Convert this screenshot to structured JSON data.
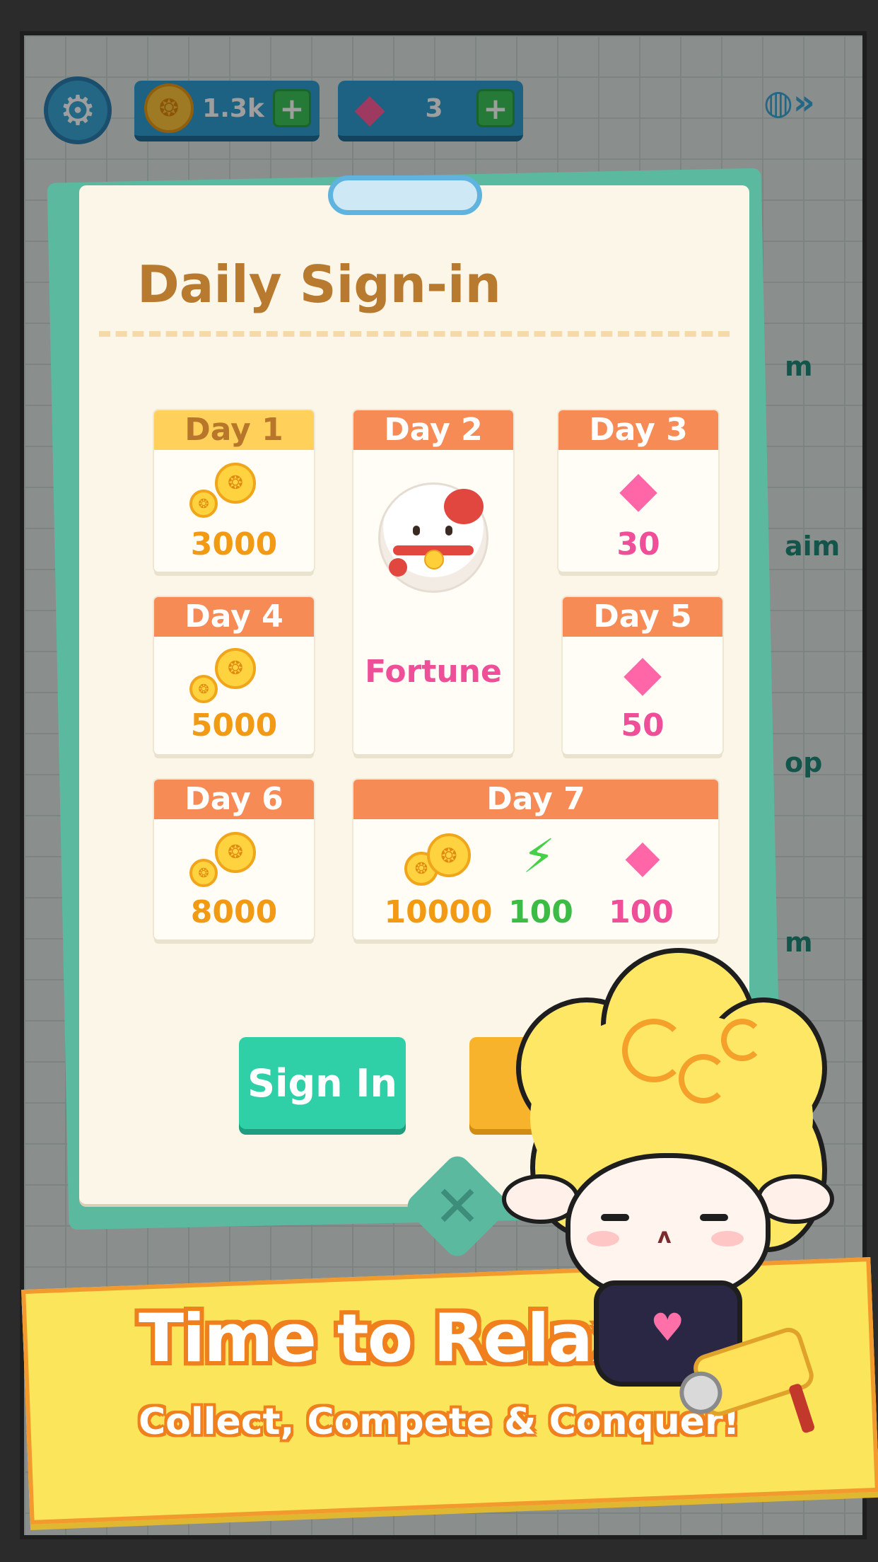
{
  "top_bar": {
    "coins": "1.3k",
    "gems": "3",
    "plus_symbol": "+"
  },
  "modal": {
    "title": "Daily Sign-in",
    "days": [
      {
        "label": "Day 1",
        "reward": "3000",
        "kind": "coin"
      },
      {
        "label": "Day 2",
        "reward": "Fortune",
        "kind": "lucky-cat"
      },
      {
        "label": "Day 3",
        "reward": "30",
        "kind": "gem"
      },
      {
        "label": "Day 4",
        "reward": "5000",
        "kind": "coin"
      },
      {
        "label": "Day 5",
        "reward": "50",
        "kind": "gem"
      },
      {
        "label": "Day 6",
        "reward": "8000",
        "kind": "coin"
      },
      {
        "label": "Day 7",
        "rewards": {
          "coins": "10000",
          "energy": "100",
          "gems": "100"
        }
      }
    ],
    "sign_in_label": "Sign In",
    "close_symbol": "✕"
  },
  "side_peek": {
    "text1": "m",
    "text2": "aim",
    "text3": "op",
    "text4": "m"
  },
  "banner": {
    "title": "Time to Relax",
    "subtitle": "Collect, Compete & Conquer!"
  },
  "colors": {
    "accent_teal": "#2fcfa8",
    "coin_orange": "#f39a14",
    "gem_pink": "#ee4f98",
    "energy_green": "#3cbb45",
    "banner_yellow": "#fbe65b"
  },
  "icons": [
    "gear-icon",
    "coin-icon",
    "gem-icon",
    "energy-icon",
    "lucky-cat-icon",
    "close-icon",
    "paint-roller-icon",
    "sheep-mascot"
  ]
}
